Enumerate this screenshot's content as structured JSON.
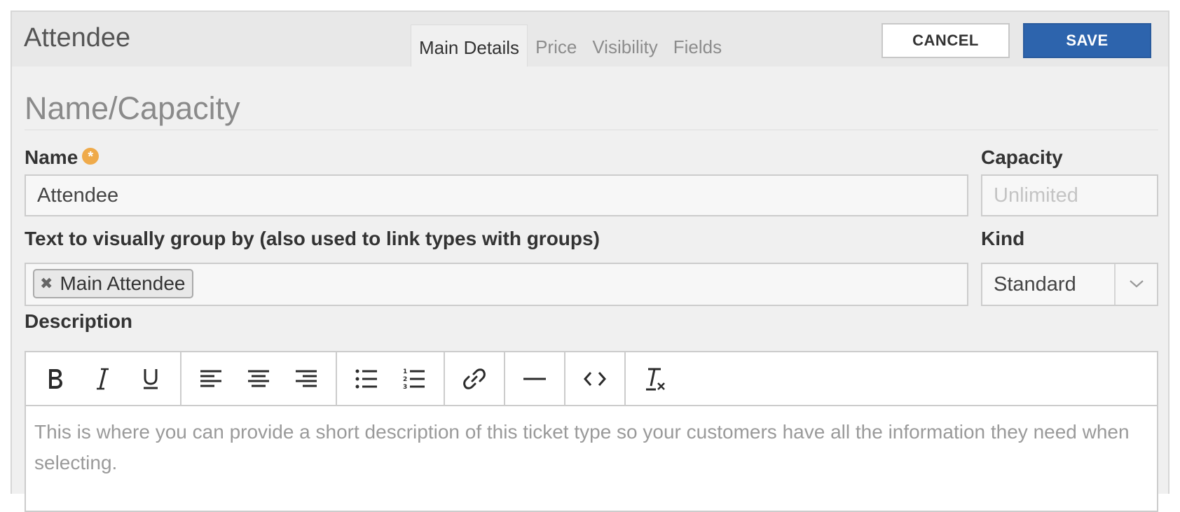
{
  "header": {
    "title": "Attendee",
    "tabs": [
      {
        "label": "Main Details",
        "active": true
      },
      {
        "label": "Price",
        "active": false
      },
      {
        "label": "Visibility",
        "active": false
      },
      {
        "label": "Fields",
        "active": false
      }
    ],
    "cancel_label": "CANCEL",
    "save_label": "SAVE"
  },
  "section": {
    "title": "Name/Capacity"
  },
  "form": {
    "name_label": "Name",
    "name_value": "Attendee",
    "capacity_label": "Capacity",
    "capacity_placeholder": "Unlimited",
    "group_label": "Text to visually group by (also used to link types with groups)",
    "group_tags": [
      "Main Attendee"
    ],
    "kind_label": "Kind",
    "kind_value": "Standard",
    "description_label": "Description",
    "description_placeholder": "This is where you can provide a short description of this ticket type so your customers have all the information they need when selecting."
  },
  "colors": {
    "accent": "#2d64ad",
    "required": "#efaa4a"
  },
  "toolbar_icons": [
    "bold-icon",
    "italic-icon",
    "underline-icon",
    "align-left-icon",
    "align-center-icon",
    "align-right-icon",
    "bullet-list-icon",
    "numbered-list-icon",
    "link-icon",
    "horizontal-rule-icon",
    "code-icon",
    "clear-format-icon"
  ]
}
